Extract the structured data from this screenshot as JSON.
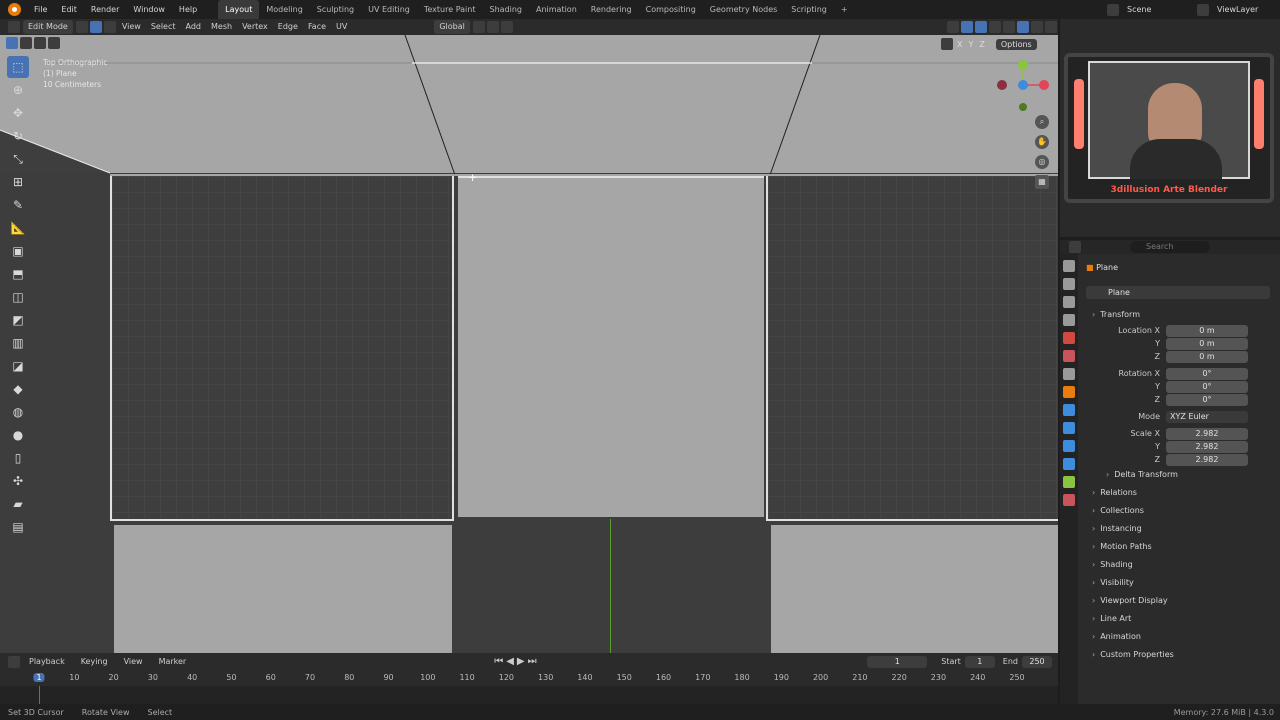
{
  "topbar": {
    "menus": [
      "File",
      "Edit",
      "Render",
      "Window",
      "Help"
    ],
    "workspaces": [
      "Layout",
      "Modeling",
      "Sculpting",
      "UV Editing",
      "Texture Paint",
      "Shading",
      "Animation",
      "Rendering",
      "Compositing",
      "Geometry Nodes",
      "Scripting"
    ],
    "active_workspace": "Layout",
    "add_tab": "+",
    "scene": "Scene",
    "view_layer": "ViewLayer"
  },
  "viewport_header": {
    "mode": "Edit Mode",
    "menus": [
      "View",
      "Select",
      "Add",
      "Mesh",
      "Vertex",
      "Edge",
      "Face",
      "UV"
    ],
    "orientation": "Global",
    "options": "Options",
    "axes": [
      "X",
      "Y",
      "Z"
    ]
  },
  "overlay": {
    "view_name": "Top Orthographic",
    "object": "(1) Plane",
    "scale": "10 Centimeters"
  },
  "gizmo": {
    "y": "Y",
    "z": "Z"
  },
  "webcam": {
    "caption": "3dillusion Arte Blender"
  },
  "properties": {
    "search_placeholder": "Search",
    "object_name": "Plane",
    "data_name": "Plane",
    "transform_label": "Transform",
    "location_label": "Location X",
    "rotation_label": "Rotation X",
    "scale_label": "Scale X",
    "y_label": "Y",
    "z_label": "Z",
    "location": [
      "0 m",
      "0 m",
      "0 m"
    ],
    "rotation": [
      "0°",
      "0°",
      "0°"
    ],
    "mode_label": "Mode",
    "mode_value": "XYZ Euler",
    "scale": [
      "2.982",
      "2.982",
      "2.982"
    ],
    "sections": [
      "Delta Transform",
      "Relations",
      "Collections",
      "Instancing",
      "Motion Paths",
      "Shading",
      "Visibility",
      "Viewport Display",
      "Line Art",
      "Animation",
      "Custom Properties"
    ]
  },
  "timeline": {
    "menus": [
      "Playback",
      "Keying",
      "View",
      "Marker"
    ],
    "current_frame": "1",
    "start_label": "Start",
    "start": "1",
    "end_label": "End",
    "end": "250",
    "ticks": [
      "1",
      "10",
      "20",
      "30",
      "40",
      "50",
      "60",
      "70",
      "80",
      "90",
      "100",
      "110",
      "120",
      "130",
      "140",
      "150",
      "160",
      "170",
      "180",
      "190",
      "200",
      "210",
      "220",
      "230",
      "240",
      "250"
    ]
  },
  "statusbar": {
    "hints": [
      "Set 3D Cursor",
      "Rotate View",
      "Select"
    ],
    "info": "Memory: 27.6 MiB | 4.3.0"
  },
  "colors": {
    "accent": "#4772b3",
    "blender_orange": "#e87d0d",
    "gizmo_x": "#e0455a",
    "gizmo_y": "#8bc53f",
    "gizmo_z": "#3d8ddc"
  }
}
